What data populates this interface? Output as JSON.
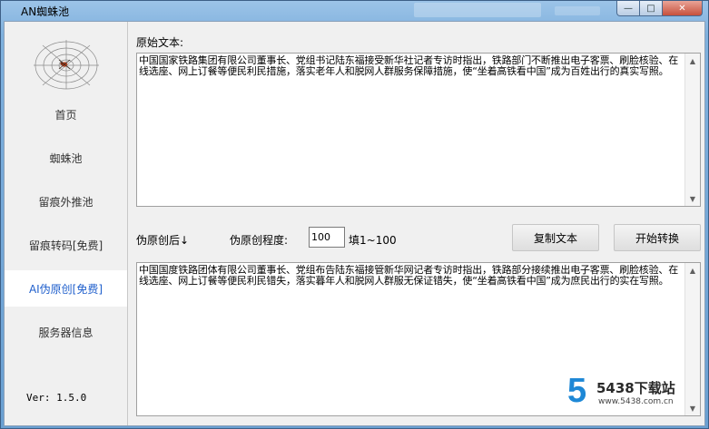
{
  "window": {
    "title": "AN蜘蛛池",
    "controls": {
      "minimize": "—",
      "maximize": "□",
      "close": "✕"
    }
  },
  "sidebar": {
    "items": [
      {
        "label": "首页",
        "active": false
      },
      {
        "label": "蜘蛛池",
        "active": false
      },
      {
        "label": "留痕外推池",
        "active": false
      },
      {
        "label": "留痕转码[免费]",
        "active": false
      },
      {
        "label": "AI伪原创[免费]",
        "active": true
      },
      {
        "label": "服务器信息",
        "active": false
      }
    ],
    "version": "Ver: 1.5.0",
    "accent_color": "#1f5fcc"
  },
  "main": {
    "original_label": "原始文本:",
    "original_text": "中国国家铁路集团有限公司董事长、党组书记陆东福接受新华社记者专访时指出，铁路部门不断推出电子客票、刷脸核验、在线选座、网上订餐等便民利民措施，落实老年人和脱网人群服务保障措施，使“坐着高铁看中国”成为百姓出行的真实写照。",
    "result_label": "伪原创后↓",
    "degree_label": "伪原创程度:",
    "degree_value": "100",
    "degree_hint": "填1~100",
    "copy_button": "复制文本",
    "convert_button": "开始转换",
    "result_text": "中国国度铁路团体有限公司董事长、党组布告陆东福接管新华网记者专访时指出，铁路部分接续推出电子客票、刷脸核验、在线选座、网上订餐等便民利民错失，落实暮年人和脱网人群服无保证错失，使“坐着高铁看中国”成为庶民出行的实在写照。"
  },
  "watermark": {
    "logo": "5",
    "title": "5438下载站",
    "url": "www.5438.com.cn"
  }
}
